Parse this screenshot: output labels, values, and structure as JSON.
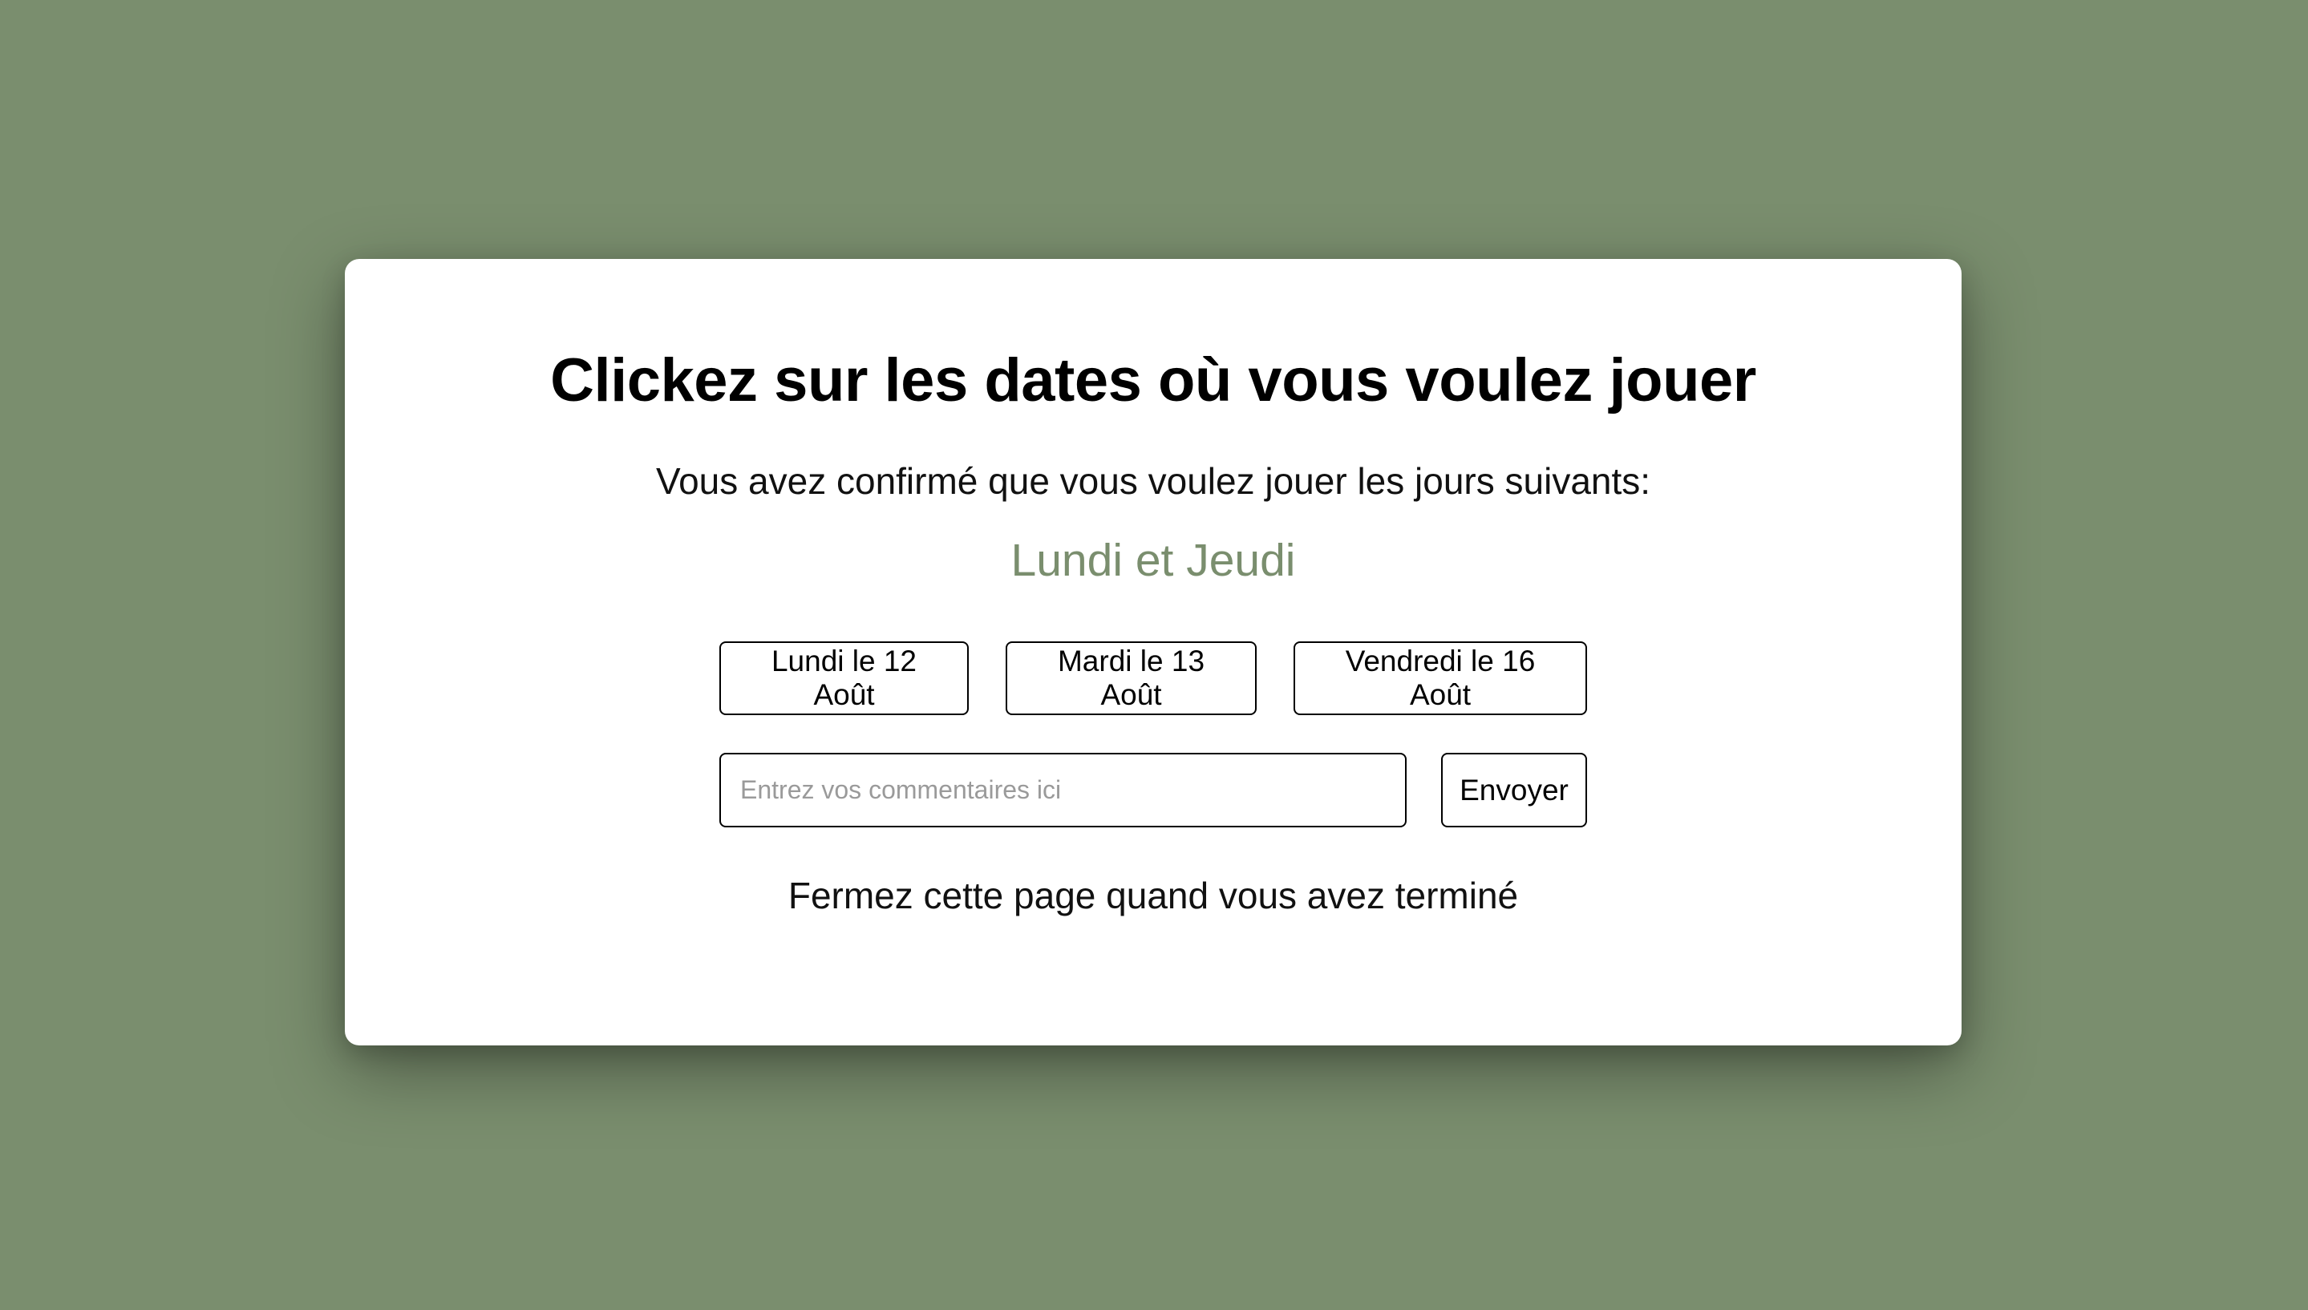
{
  "dialog": {
    "title": "Clickez sur les dates où vous voulez jouer",
    "confirmation_text": "Vous avez confirmé que vous voulez jouer les jours suivants:",
    "confirmed_days": "Lundi et Jeudi",
    "date_buttons": [
      {
        "label": "Lundi le 12 Août"
      },
      {
        "label": "Mardi le 13 Août"
      },
      {
        "label": "Vendredi le 16 Août"
      }
    ],
    "comment": {
      "placeholder": "Entrez vos commentaires ici",
      "value": ""
    },
    "send_label": "Envoyer",
    "footer_note": "Fermez cette page quand vous avez terminé"
  },
  "colors": {
    "background": "#7a8e6e",
    "accent": "#7a8e6e",
    "card": "#ffffff"
  }
}
